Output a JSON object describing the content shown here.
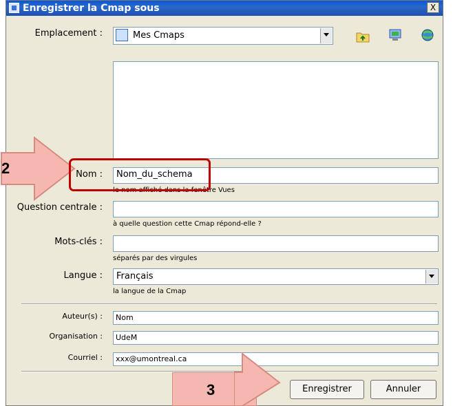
{
  "dialog": {
    "title": "Enregistrer la Cmap sous",
    "close_label": "X"
  },
  "location": {
    "label": "Emplacement :",
    "value": "Mes Cmaps",
    "icons": [
      "folder-up-icon",
      "desktop-icon",
      "network-globe-icon"
    ]
  },
  "name_field": {
    "label": "Nom :",
    "value": "Nom_du_schema",
    "hint": "le nom affiché dans la fenêtre Vues"
  },
  "question_field": {
    "label": "Question centrale :",
    "value": "",
    "hint": "à quelle question cette Cmap répond-elle ?"
  },
  "keywords_field": {
    "label": "Mots-clés :",
    "value": "",
    "hint": "séparés par des virgules"
  },
  "language_field": {
    "label": "Langue :",
    "value": "Français",
    "hint": "la langue de la Cmap"
  },
  "author_field": {
    "label": "Auteur(s) :",
    "value": "Nom"
  },
  "org_field": {
    "label": "Organisation :",
    "value": "UdeM"
  },
  "email_field": {
    "label": "Courriel :",
    "value": "xxx@umontreal.ca"
  },
  "buttons": {
    "save": "Enregistrer",
    "cancel": "Annuler"
  },
  "annotations": {
    "step2": "2",
    "step3": "3",
    "arrow_color": "#f4b8b0",
    "highlight_color": "#c00000"
  }
}
